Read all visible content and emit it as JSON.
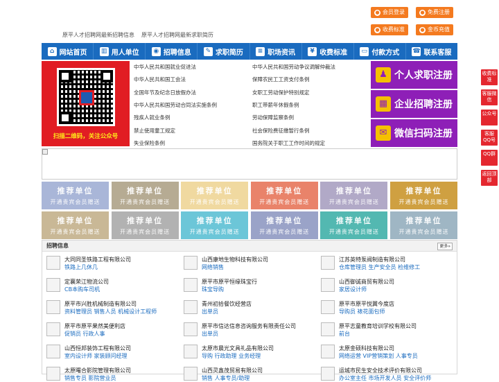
{
  "top_links": [
    "原平人才招聘网最新招聘信息",
    "原平人才招聘网最新求职简历"
  ],
  "top_buttons": [
    {
      "label": "会员登录",
      "icon": "user-icon"
    },
    {
      "label": "免费注册",
      "icon": "register-icon"
    },
    {
      "label": "收费标准",
      "icon": "yen-icon"
    },
    {
      "label": "金币充值",
      "icon": "coin-icon"
    }
  ],
  "nav": [
    {
      "label": "网站首页",
      "icon": "home-icon",
      "glyph": "⌂"
    },
    {
      "label": "用人单位",
      "icon": "building-icon",
      "glyph": "▥"
    },
    {
      "label": "招聘信息",
      "icon": "recruit-icon",
      "glyph": "◉"
    },
    {
      "label": "求职简历",
      "icon": "resume-icon",
      "glyph": "✎"
    },
    {
      "label": "职场资讯",
      "icon": "news-icon",
      "glyph": "≡"
    },
    {
      "label": "收费标准",
      "icon": "fee-icon",
      "glyph": "¥"
    },
    {
      "label": "付款方式",
      "icon": "payment-icon",
      "glyph": "▭"
    },
    {
      "label": "联系客服",
      "icon": "service-icon",
      "glyph": "☎"
    }
  ],
  "qr_caption": "扫描二维码，关注公众号",
  "laws_left": [
    "中华人民共和国就业促进法",
    "中华人民共和国工会法",
    "全国年节及纪念日放假办法",
    "中华人民共和国劳动合同法实施条例",
    "残疾人就业条例",
    "禁止使用童工规定",
    "失业保险条例"
  ],
  "laws_right": [
    "中华人民共和国劳动争议调解仲裁法",
    "保障农民工工资支付条例",
    "女职工劳动保护特别规定",
    "职工带薪年休假条例",
    "劳动保障监察条例",
    "社会保险费征缴暂行条例",
    "国务院关于职工工作时间的规定"
  ],
  "register": [
    {
      "label": "个人求职注册",
      "icon": "person-icon",
      "glyph": "♟"
    },
    {
      "label": "企业招聘注册",
      "icon": "enterprise-icon",
      "glyph": "▦"
    },
    {
      "label": "微信扫码注册",
      "icon": "wechat-icon",
      "glyph": "✉"
    }
  ],
  "tile": {
    "title": "推荐单位",
    "subtitle": "开通贵宾会员赠送"
  },
  "tile_colors": [
    "#a9b6d8",
    "#b6ab93",
    "#f0d9a0",
    "#e9836a",
    "#b1a9c7",
    "#cfa041",
    "#c9b896",
    "#b2b2b2",
    "#6cc6d8",
    "#9aa3c8",
    "#53b8b1",
    "#9fb6c4"
  ],
  "jobs_title": "招聘信息",
  "more_label": "更多»",
  "companies": [
    {
      "name": "大同同圣铁路工程有限公司",
      "positions": "铁路上几休几"
    },
    {
      "name": "山西康地生物科技有限公司",
      "positions": "网络销售"
    },
    {
      "name": "江苏英特泵阀制造有限公司",
      "positions": "仓库管理员 生产安全员 检维修工"
    },
    {
      "name": "定襄荣江物流公司",
      "positions": "CB本购车司机"
    },
    {
      "name": "原平市原平恒缘珠宝行",
      "positions": "珠宝导购"
    },
    {
      "name": "山西御诚商贸有限公司",
      "positions": "家居设计师"
    },
    {
      "name": "原平市兴胜机械制造有限公司",
      "positions": "资料管理员 销售人员 机械设计工程师"
    },
    {
      "name": "青州初拾餐饮经营店",
      "positions": "出单员"
    },
    {
      "name": "原平市原平悦翼今度店",
      "positions": "导购员 裱花面包师"
    },
    {
      "name": "原平市原平果然美便利店",
      "positions": "促销员 行政人事"
    },
    {
      "name": "原平市信达信息咨询服务有限责任公司",
      "positions": "出单员"
    },
    {
      "name": "原平志童教育培训学校有限公司",
      "positions": "前台"
    },
    {
      "name": "山西恒邦装饰工程有限公司",
      "positions": "室内设计师 家装顾问经理"
    },
    {
      "name": "太原市晨光文具礼品有限公司",
      "positions": "导购 行政助理 业务经理"
    },
    {
      "name": "太原金硕科技有限公司",
      "positions": "网络运营 VIP营销策划 人事专员"
    },
    {
      "name": "太原曙合影院管理有限公司",
      "positions": "销售专员 影院营业员"
    },
    {
      "name": "山西灵鑫茂贸易有限公司",
      "positions": "销售 人事专员/助理"
    },
    {
      "name": "运城市民生安全技术评价有限公司",
      "positions": "办公室主任 市场开发人员 安全评价师"
    }
  ],
  "sidebar": [
    {
      "label": "收费标准",
      "icon": "fee-icon"
    },
    {
      "label": "客服微信",
      "icon": "wechat-icon"
    },
    {
      "label": "公众号",
      "icon": "official-account-icon"
    },
    {
      "label": "客服QQ号",
      "icon": "qq-icon"
    },
    {
      "label": "QQ群",
      "icon": "qq-group-icon"
    },
    {
      "label": "返回顶部",
      "icon": "back-to-top-icon"
    }
  ]
}
